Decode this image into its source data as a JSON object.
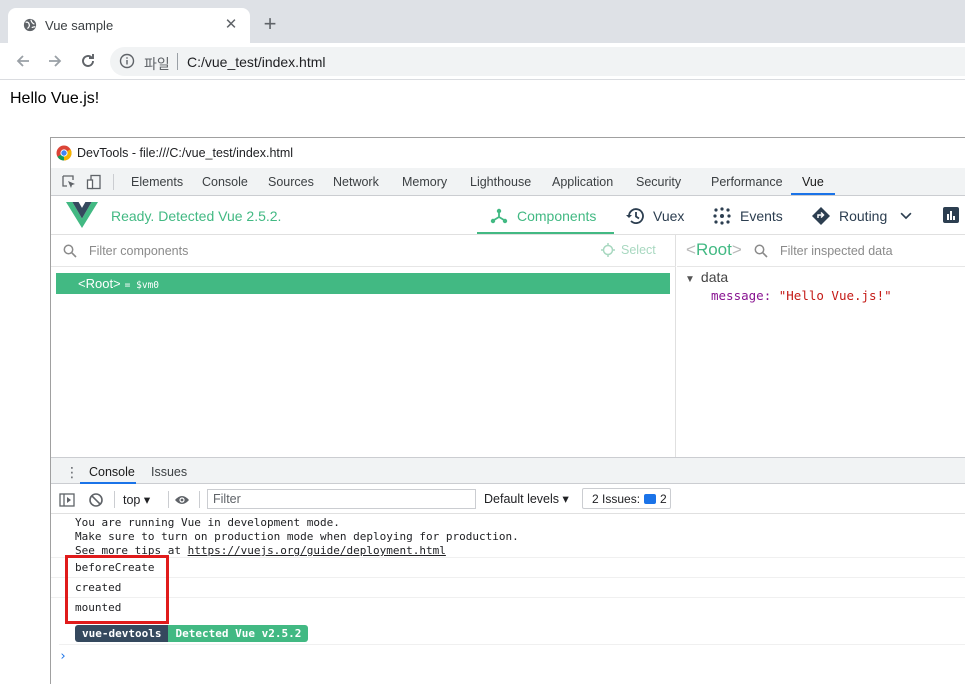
{
  "browser": {
    "tab_title": "Vue sample",
    "tab_close": "✕",
    "new_tab": "+",
    "scheme_label": "파일",
    "url": "C:/vue_test/index.html"
  },
  "page": {
    "content": "Hello Vue.js!"
  },
  "devtools": {
    "window_title": "DevTools - file:///C:/vue_test/index.html",
    "tabs": [
      "Elements",
      "Console",
      "Sources",
      "Network",
      "Memory",
      "Lighthouse",
      "Application",
      "Security",
      "Performance",
      "Vue"
    ],
    "active_tab": "Vue"
  },
  "vue": {
    "status": "Ready. Detected Vue 2.5.2.",
    "nav": {
      "components": "Components",
      "vuex": "Vuex",
      "events": "Events",
      "routing": "Routing"
    },
    "filter_components_placeholder": "Filter components",
    "select_label": "Select",
    "tree": {
      "root_label": "<Root>",
      "vm_label": "= $vm0"
    },
    "inspector": {
      "root_name": "Root",
      "filter_placeholder": "Filter inspected data",
      "section": "data",
      "prop_key": "message",
      "prop_value": "\"Hello Vue.js!\""
    }
  },
  "drawer": {
    "tabs": [
      "Console",
      "Issues"
    ]
  },
  "console": {
    "context": "top",
    "filter_placeholder": "Filter",
    "levels": "Default levels",
    "issues_label": "2 Issues:",
    "issues_count": "2",
    "dev_mode_lines": [
      "You are running Vue in development mode.",
      "Make sure to turn on production mode when deploying for production.",
      "See more tips at"
    ],
    "dev_mode_link": "https://vuejs.org/guide/deployment.html",
    "logs": [
      "beforeCreate",
      "created",
      "mounted"
    ],
    "badge_name": "vue-devtools",
    "badge_text": "Detected Vue v2.5.2",
    "prompt": "›"
  },
  "colors": {
    "vue_green": "#42b983",
    "vue_dark": "#35495e",
    "highlight_red": "#e01b1b",
    "devtools_blue": "#1a73e8"
  }
}
